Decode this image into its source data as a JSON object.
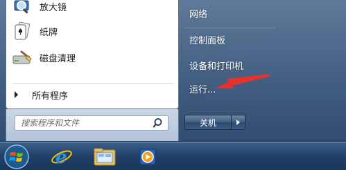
{
  "start_menu": {
    "programs": [
      {
        "label": "放大镜",
        "icon": "magnifier-icon"
      },
      {
        "label": "纸牌",
        "icon": "solitaire-icon"
      },
      {
        "label": "磁盘清理",
        "icon": "disk-cleanup-icon"
      }
    ],
    "all_programs_label": "所有程序",
    "search_placeholder": "搜索程序和文件",
    "right_items": [
      {
        "label": "网络"
      },
      {
        "label": "控制面板"
      },
      {
        "label": "设备和打印机"
      },
      {
        "label": "运行..."
      }
    ],
    "shutdown_label": "关机"
  },
  "taskbar": {
    "pinned": [
      {
        "icon": "internet-explorer-icon"
      },
      {
        "icon": "windows-explorer-icon"
      },
      {
        "icon": "media-player-icon"
      }
    ]
  },
  "annotation": {
    "color": "#e8312a",
    "points_to": "运行..."
  }
}
